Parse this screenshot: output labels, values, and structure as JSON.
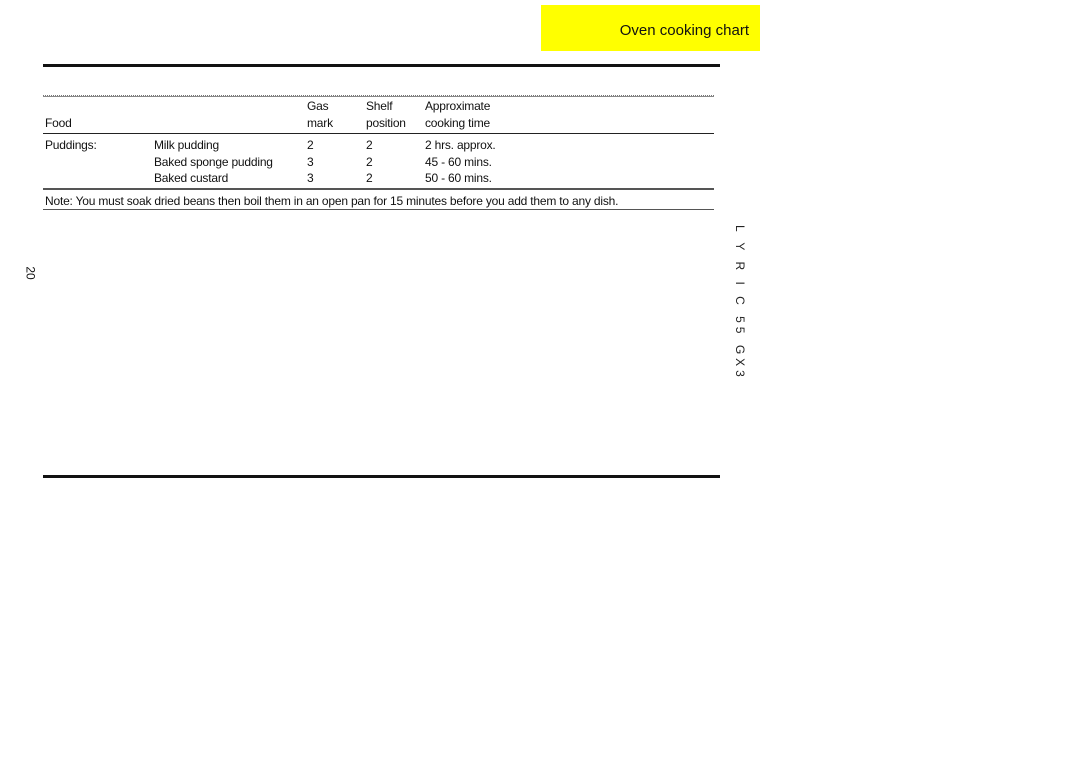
{
  "header": {
    "section_title": "Oven cooking chart",
    "accent_color": "#ffff00"
  },
  "table": {
    "columns": [
      {
        "line1": "",
        "line2": "Food"
      },
      {
        "line1": "Gas",
        "line2": "mark"
      },
      {
        "line1": "Shelf",
        "line2": "position"
      },
      {
        "line1": "Approximate",
        "line2": "cooking time"
      }
    ],
    "category": "Puddings:",
    "rows": [
      {
        "food": "Milk pudding",
        "gas_mark": "2",
        "shelf": "2",
        "time": "2 hrs. approx."
      },
      {
        "food": "Baked sponge pudding",
        "gas_mark": "3",
        "shelf": "2",
        "time": "45 - 60 mins."
      },
      {
        "food": "Baked custard",
        "gas_mark": "3",
        "shelf": "2",
        "time": "50 - 60 mins."
      }
    ],
    "note": "Note: You must soak dried beans then boil them in an open pan for 15 minutes before you add them to any dish."
  },
  "page_number": "20",
  "model_label": "L Y R I C  55  GX3"
}
